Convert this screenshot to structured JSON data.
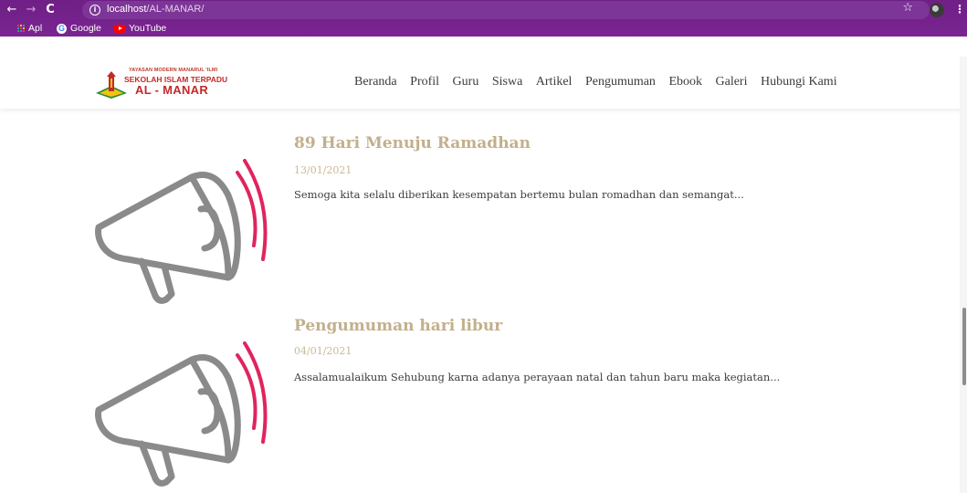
{
  "browser": {
    "url_host": "localhost",
    "url_path": "/AL-MANAR/",
    "bookmarks": [
      {
        "label": "Apl",
        "icon": "apps-grid-icon"
      },
      {
        "label": "Google",
        "icon": "google-icon"
      },
      {
        "label": "YouTube",
        "icon": "youtube-icon"
      }
    ],
    "colors": {
      "chrome": "#7a2591"
    }
  },
  "site": {
    "logo": {
      "line1": "YAYASAN MODERN MANARUL 'ILMI",
      "line2": "SEKOLAH ISLAM TERPADU",
      "line3": "AL - MANAR"
    },
    "nav": [
      "Beranda",
      "Profil",
      "Guru",
      "Siswa",
      "Artikel",
      "Pengumuman",
      "Ebook",
      "Galeri",
      "Hubungi Kami"
    ]
  },
  "announcements": [
    {
      "title": "89 Hari Menuju Ramadhan",
      "date": "13/01/2021",
      "excerpt": "Semoga kita selalu diberikan kesempatan bertemu bulan romadhan dan semangat...",
      "icon": "megaphone-icon"
    },
    {
      "title": "Pengumuman hari libur",
      "date": "04/01/2021",
      "excerpt": "Assalamualaikum Sehubung karna adanya perayaan natal dan tahun baru maka kegiatan...",
      "icon": "megaphone-icon"
    }
  ],
  "colors": {
    "title": "#c2b08c",
    "megaphone_body": "#8a8a8a",
    "megaphone_waves": "#e0245e"
  }
}
